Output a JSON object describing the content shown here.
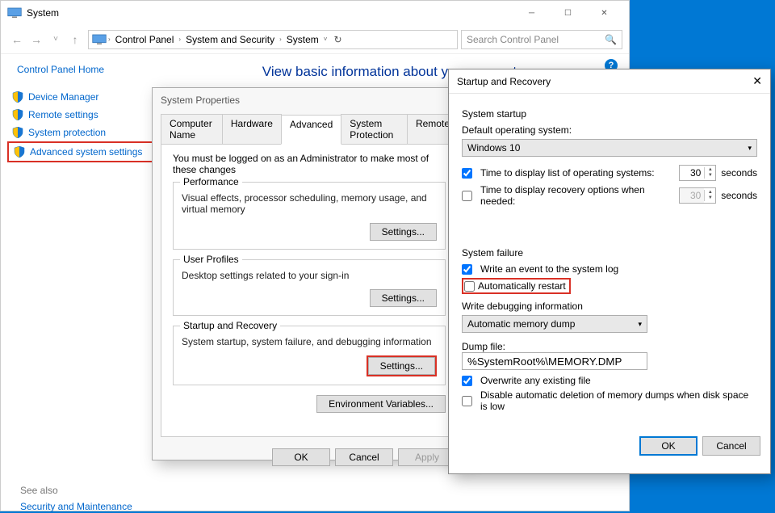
{
  "title": "System",
  "breadcrumbs": [
    "Control Panel",
    "System and Security",
    "System"
  ],
  "search_placeholder": "Search Control Panel",
  "sidebar": {
    "home": "Control Panel Home",
    "items": [
      {
        "icon": "shield",
        "label": "Device Manager"
      },
      {
        "icon": "shield",
        "label": "Remote settings"
      },
      {
        "icon": "shield",
        "label": "System protection"
      },
      {
        "icon": "shield",
        "label": "Advanced system settings",
        "highlight": true
      }
    ],
    "see_also": "See also",
    "sec_maint": "Security and Maintenance"
  },
  "main": {
    "heading": "View basic information about your computer"
  },
  "sysprops": {
    "title": "System Properties",
    "tabs": [
      "Computer Name",
      "Hardware",
      "Advanced",
      "System Protection",
      "Remote"
    ],
    "active_tab": 2,
    "note": "You must be logged on as an Administrator to make most of these changes",
    "groups": {
      "perf": {
        "title": "Performance",
        "desc": "Visual effects, processor scheduling, memory usage, and virtual memory",
        "btn": "Settings..."
      },
      "profiles": {
        "title": "User Profiles",
        "desc": "Desktop settings related to your sign-in",
        "btn": "Settings..."
      },
      "startup": {
        "title": "Startup and Recovery",
        "desc": "System startup, system failure, and debugging information",
        "btn": "Settings..."
      }
    },
    "env_btn": "Environment Variables...",
    "ok": "OK",
    "cancel": "Cancel",
    "apply": "Apply"
  },
  "sr": {
    "title": "Startup and Recovery",
    "sys_startup": "System startup",
    "default_os_label": "Default operating system:",
    "default_os_value": "Windows 10",
    "time_list_label": "Time to display list of operating systems:",
    "time_list_value": "30",
    "time_list_checked": true,
    "seconds": "seconds",
    "time_recovery_label": "Time to display recovery options when needed:",
    "time_recovery_value": "30",
    "time_recovery_checked": false,
    "sys_failure": "System failure",
    "write_event": "Write an event to the system log",
    "write_event_checked": true,
    "auto_restart": "Automatically restart",
    "auto_restart_checked": false,
    "write_debug": "Write debugging information",
    "dump_type": "Automatic memory dump",
    "dump_file_label": "Dump file:",
    "dump_file_value": "%SystemRoot%\\MEMORY.DMP",
    "overwrite": "Overwrite any existing file",
    "overwrite_checked": true,
    "disable_del": "Disable automatic deletion of memory dumps when disk space is low",
    "disable_del_checked": false,
    "ok": "OK",
    "cancel": "Cancel"
  }
}
